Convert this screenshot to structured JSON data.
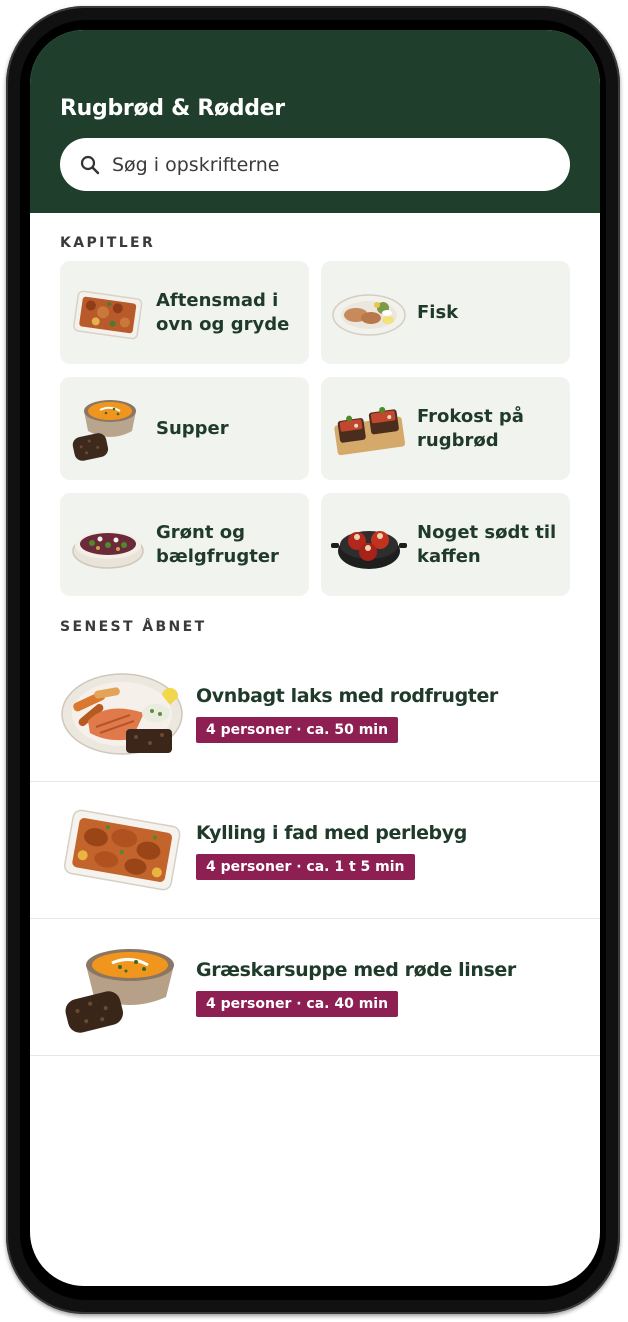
{
  "app": {
    "title": "Rugbrød & Rødder"
  },
  "search": {
    "placeholder": "Søg i opskrifterne"
  },
  "chapters": {
    "section_label": "KAPITLER",
    "items": [
      {
        "label": "Aftensmad i ovn og gryde",
        "icon": "casserole-dish-icon"
      },
      {
        "label": "Fisk",
        "icon": "fish-plate-icon"
      },
      {
        "label": "Supper",
        "icon": "soup-bowl-icon"
      },
      {
        "label": "Frokost på rugbrød",
        "icon": "open-sandwich-icon"
      },
      {
        "label": "Grønt og bælgfrugter",
        "icon": "salad-bowl-icon"
      },
      {
        "label": "Noget sødt til kaffen",
        "icon": "baked-apples-icon"
      }
    ]
  },
  "recent": {
    "section_label": "SENEST ÅBNET",
    "items": [
      {
        "title": "Ovnbagt laks med rodfrugter",
        "meta": "4 personer · ca. 50 min",
        "icon": "salmon-plate-icon"
      },
      {
        "title": "Kylling i fad med perlebyg",
        "meta": "4 personer · ca. 1 t 5 min",
        "icon": "chicken-dish-icon"
      },
      {
        "title": "Græskarsuppe med røde linser",
        "meta": "4 personer · ca. 40 min",
        "icon": "pumpkin-soup-icon"
      }
    ]
  },
  "colors": {
    "header_bg": "#1f3f2c",
    "badge_bg": "#8d1f52",
    "chapter_bg": "#f1f3ef",
    "title_text": "#1f3a2a"
  }
}
